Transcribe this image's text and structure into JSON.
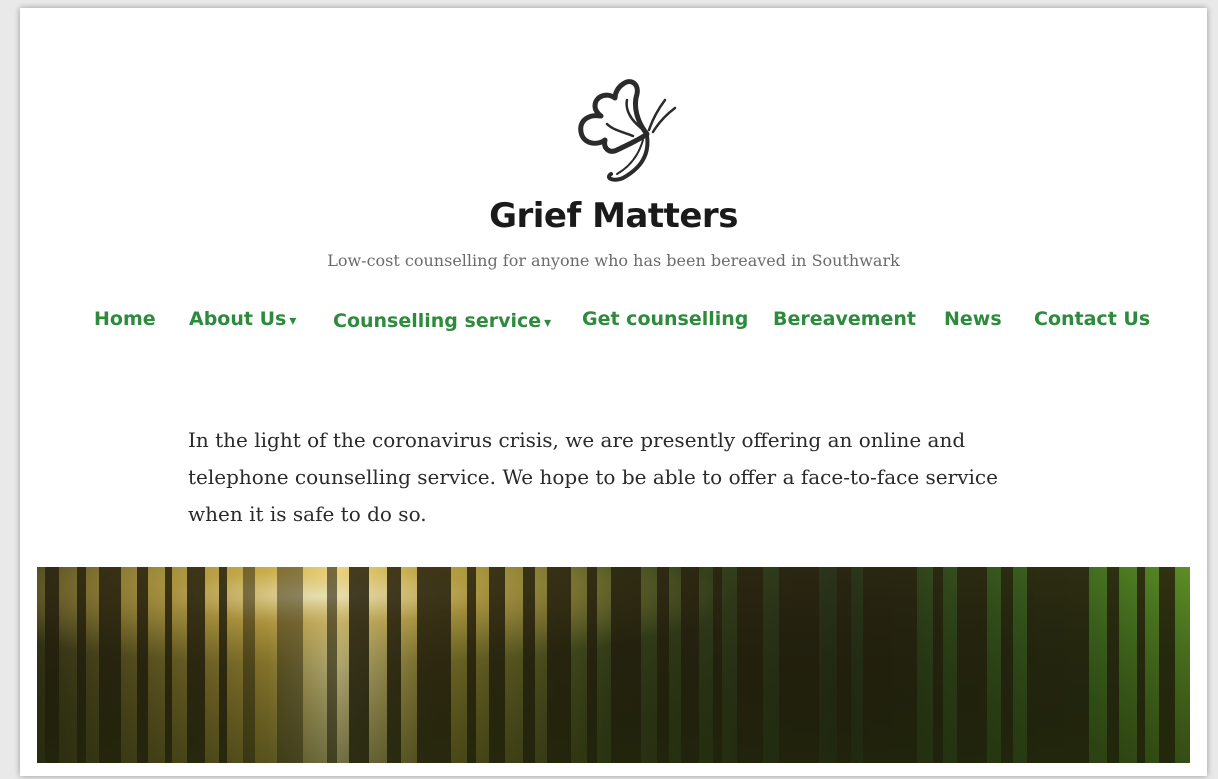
{
  "site": {
    "title": "Grief Matters",
    "tagline": "Low-cost counselling for anyone who has been bereaved in Southwark",
    "logo_icon": "butterfly-icon"
  },
  "nav": {
    "items": [
      {
        "label": "Home",
        "has_dropdown": false
      },
      {
        "label": "About Us",
        "has_dropdown": true
      },
      {
        "label": "Counselling service",
        "has_dropdown": true
      },
      {
        "label": "Get counselling",
        "has_dropdown": false
      },
      {
        "label": "Bereavement",
        "has_dropdown": false
      },
      {
        "label": "News",
        "has_dropdown": false
      },
      {
        "label": "Contact Us",
        "has_dropdown": false
      }
    ],
    "dropdown_glyph": "▾"
  },
  "intro": {
    "text": "In the light of the coronavirus crisis, we are presently offering an online and telephone counselling service. We hope to be able to offer a face-to-face service when it is safe to do so."
  },
  "colors": {
    "nav_link": "#2e8b3d",
    "title": "#1a1a1a",
    "tagline": "#6b6b6b",
    "body_text": "#2a2a2a"
  }
}
